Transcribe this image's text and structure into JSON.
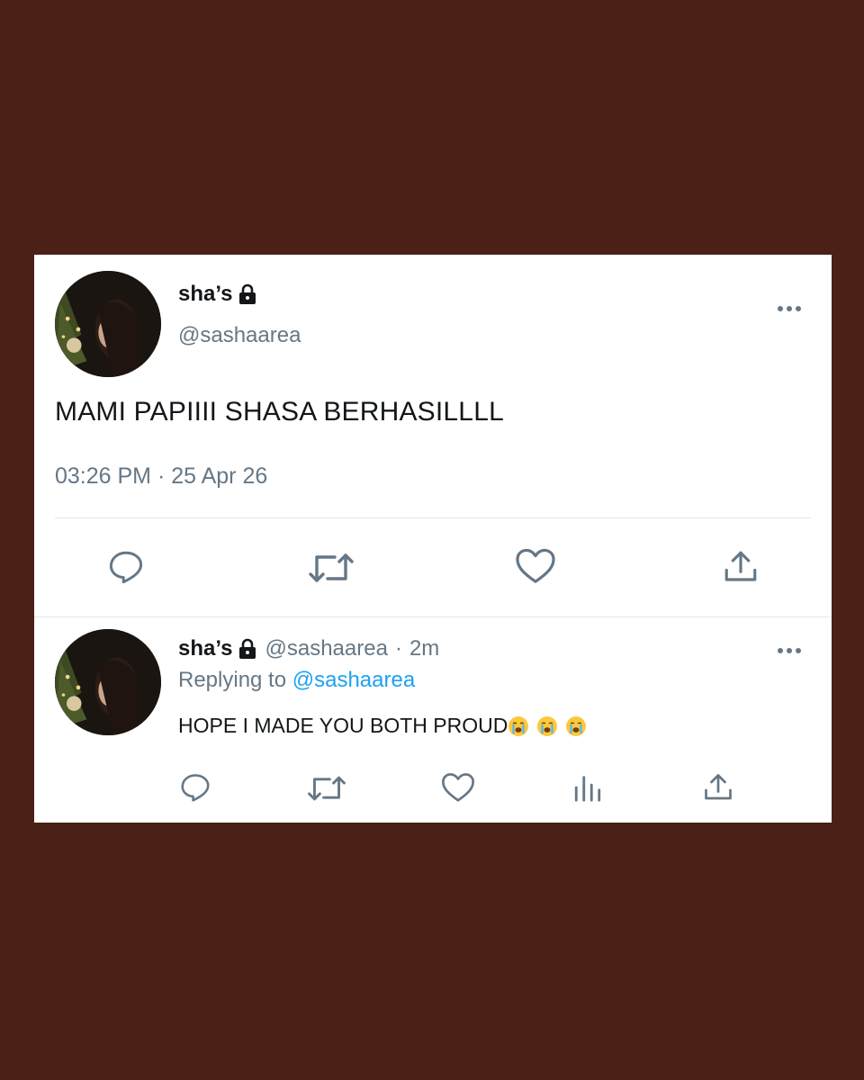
{
  "main_tweet": {
    "display_name": "sha’s",
    "handle": "@sashaarea",
    "text": "MAMI PAPIIII SHASA BERHASILLLL",
    "timestamp": "03:26 PM · 25 Apr 26",
    "icons": [
      "avatar",
      "lock-icon",
      "more-icon",
      "reply-icon",
      "retweet-icon",
      "like-icon",
      "share-icon"
    ]
  },
  "reply_tweet": {
    "display_name": "sha’s",
    "handle": "@sashaarea",
    "separator": "·",
    "time_ago": "2m",
    "replying_prefix": "Replying to",
    "replying_handle": "@sashaarea",
    "text": "HOPE I MADE YOU BOTH PROUD",
    "emojis": [
      "crying-face-emoji",
      "crying-face-emoji",
      "crying-face-emoji"
    ],
    "icons": [
      "avatar",
      "lock-icon",
      "more-icon",
      "reply-icon",
      "retweet-icon",
      "like-icon",
      "analytics-icon",
      "share-icon"
    ]
  },
  "colors": {
    "background": "#4a2017",
    "card": "#ffffff",
    "text": "#14171a",
    "secondary": "#657786",
    "link": "#1da1f2"
  }
}
